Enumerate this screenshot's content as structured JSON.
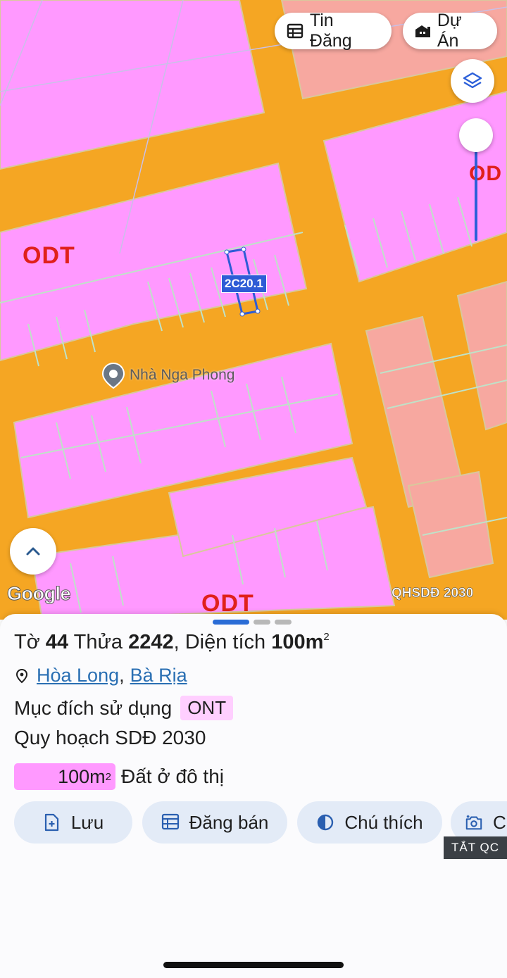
{
  "map": {
    "zone_labels": [
      "ODT",
      "ODT",
      "ODT"
    ],
    "partial_zone_label": "OD",
    "top_buttons": {
      "listings_label": "Tin Đăng",
      "projects_label": "Dự Án"
    },
    "layers_icon": "layers-icon",
    "parcel_tag": "2C20.1",
    "poi_name": "Nhà Nga Phong",
    "google_logo": "Google",
    "plan_overlay": "QHSDĐ 2030",
    "colors": {
      "road": "#f5a623",
      "residential": "#ff99ff",
      "rural": "#f7a8a0",
      "highlight": "#2e5cd6"
    }
  },
  "sheet": {
    "title": {
      "sheet_word": "Tờ",
      "sheet_no": "44",
      "lot_word": "Thửa",
      "lot_no": "2242",
      "area_word": "Diện tích",
      "area_value": "100m",
      "area_unit_sup": "2"
    },
    "location": {
      "ward": "Hòa Long",
      "separator": ",",
      "city": "Bà Rịa"
    },
    "purpose": {
      "label": "Mục đích sử dụng",
      "code": "ONT"
    },
    "plan_label": "Quy hoạch SDĐ 2030",
    "land": {
      "area": "100m",
      "area_sup": "2",
      "type": "Đất ở đô thị",
      "color": "#ff99ff"
    },
    "actions": {
      "save": "Lưu",
      "post_sale": "Đăng bán",
      "legend": "Chú thích",
      "capture": "C"
    },
    "ad_off": "TẮT QC"
  }
}
